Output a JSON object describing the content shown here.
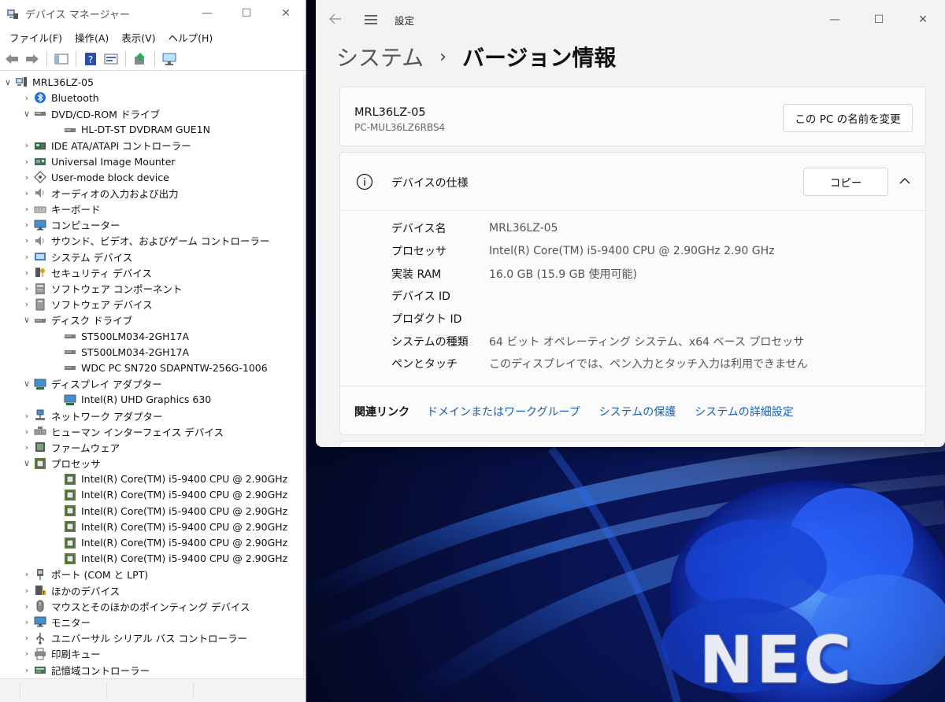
{
  "devmgr": {
    "title": "デバイス マネージャー",
    "controls": [
      "—",
      "☐",
      "✕"
    ],
    "menus": [
      "ファイル(F)",
      "操作(A)",
      "表示(V)",
      "ヘルプ(H)"
    ],
    "tree": [
      {
        "level": 0,
        "exp": "∨",
        "icon": "computer-icon",
        "label": "MRL36LZ-05"
      },
      {
        "level": 1,
        "exp": "›",
        "icon": "bluetooth-icon",
        "label": "Bluetooth"
      },
      {
        "level": 1,
        "exp": "∨",
        "icon": "dvd-drive-icon",
        "label": "DVD/CD-ROM ドライブ"
      },
      {
        "level": 2,
        "exp": "",
        "icon": "dvd-drive-icon",
        "label": "HL-DT-ST DVDRAM GUE1N"
      },
      {
        "level": 1,
        "exp": "›",
        "icon": "ide-controller-icon",
        "label": "IDE ATA/ATAPI コントローラー"
      },
      {
        "level": 1,
        "exp": "›",
        "icon": "controller-icon",
        "label": "Universal Image Mounter"
      },
      {
        "level": 1,
        "exp": "›",
        "icon": "block-device-icon",
        "label": "User-mode block device"
      },
      {
        "level": 1,
        "exp": "›",
        "icon": "speaker-icon",
        "label": "オーディオの入力および出力"
      },
      {
        "level": 1,
        "exp": "›",
        "icon": "keyboard-icon",
        "label": "キーボード"
      },
      {
        "level": 1,
        "exp": "›",
        "icon": "monitor-icon",
        "label": "コンピューター"
      },
      {
        "level": 1,
        "exp": "›",
        "icon": "speaker-icon",
        "label": "サウンド、ビデオ、およびゲーム コントローラー"
      },
      {
        "level": 1,
        "exp": "›",
        "icon": "system-folder-icon",
        "label": "システム デバイス"
      },
      {
        "level": 1,
        "exp": "›",
        "icon": "security-key-icon",
        "label": "セキュリティ デバイス"
      },
      {
        "level": 1,
        "exp": "›",
        "icon": "software-component-icon",
        "label": "ソフトウェア コンポーネント"
      },
      {
        "level": 1,
        "exp": "›",
        "icon": "software-device-icon",
        "label": "ソフトウェア デバイス"
      },
      {
        "level": 1,
        "exp": "∨",
        "icon": "disk-drive-icon",
        "label": "ディスク ドライブ"
      },
      {
        "level": 2,
        "exp": "",
        "icon": "disk-drive-icon",
        "label": "ST500LM034-2GH17A"
      },
      {
        "level": 2,
        "exp": "",
        "icon": "disk-drive-icon",
        "label": "ST500LM034-2GH17A"
      },
      {
        "level": 2,
        "exp": "",
        "icon": "disk-drive-icon",
        "label": "WDC PC SN720 SDAPNTW-256G-1006"
      },
      {
        "level": 1,
        "exp": "∨",
        "icon": "display-adapter-icon",
        "label": "ディスプレイ アダプター"
      },
      {
        "level": 2,
        "exp": "",
        "icon": "display-adapter-icon",
        "label": "Intel(R) UHD Graphics 630"
      },
      {
        "level": 1,
        "exp": "›",
        "icon": "network-adapter-icon",
        "label": "ネットワーク アダプター"
      },
      {
        "level": 1,
        "exp": "›",
        "icon": "hid-icon",
        "label": "ヒューマン インターフェイス デバイス"
      },
      {
        "level": 1,
        "exp": "›",
        "icon": "firmware-icon",
        "label": "ファームウェア"
      },
      {
        "level": 1,
        "exp": "∨",
        "icon": "processor-icon",
        "label": "プロセッサ"
      },
      {
        "level": 2,
        "exp": "",
        "icon": "processor-icon",
        "label": "Intel(R) Core(TM) i5-9400 CPU @ 2.90GHz"
      },
      {
        "level": 2,
        "exp": "",
        "icon": "processor-icon",
        "label": "Intel(R) Core(TM) i5-9400 CPU @ 2.90GHz"
      },
      {
        "level": 2,
        "exp": "",
        "icon": "processor-icon",
        "label": "Intel(R) Core(TM) i5-9400 CPU @ 2.90GHz"
      },
      {
        "level": 2,
        "exp": "",
        "icon": "processor-icon",
        "label": "Intel(R) Core(TM) i5-9400 CPU @ 2.90GHz"
      },
      {
        "level": 2,
        "exp": "",
        "icon": "processor-icon",
        "label": "Intel(R) Core(TM) i5-9400 CPU @ 2.90GHz"
      },
      {
        "level": 2,
        "exp": "",
        "icon": "processor-icon",
        "label": "Intel(R) Core(TM) i5-9400 CPU @ 2.90GHz"
      },
      {
        "level": 1,
        "exp": "›",
        "icon": "port-icon",
        "label": "ポート (COM と LPT)"
      },
      {
        "level": 1,
        "exp": "›",
        "icon": "other-device-icon",
        "label": "ほかのデバイス"
      },
      {
        "level": 1,
        "exp": "›",
        "icon": "mouse-icon",
        "label": "マウスとそのほかのポインティング デバイス"
      },
      {
        "level": 1,
        "exp": "›",
        "icon": "monitor-icon",
        "label": "モニター"
      },
      {
        "level": 1,
        "exp": "›",
        "icon": "usb-icon",
        "label": "ユニバーサル シリアル バス コントローラー"
      },
      {
        "level": 1,
        "exp": "›",
        "icon": "printer-icon",
        "label": "印刷キュー"
      },
      {
        "level": 1,
        "exp": "›",
        "icon": "storage-controller-icon",
        "label": "記憶域コントローラー"
      }
    ]
  },
  "settings": {
    "app_title": "設定",
    "controls": [
      "—",
      "☐",
      "✕"
    ],
    "breadcrumb": {
      "parent": "システム",
      "separator": "›",
      "current": "バージョン情報"
    },
    "device": {
      "name": "MRL36LZ-05",
      "model": "PC-MUL36LZ6RBS4",
      "rename_label": "この PC の名前を変更"
    },
    "spec": {
      "title": "デバイスの仕様",
      "copy_label": "コピー",
      "rows": [
        {
          "label": "デバイス名",
          "value": "MRL36LZ-05"
        },
        {
          "label": "プロセッサ",
          "value": "Intel(R) Core(TM) i5-9400 CPU @ 2.90GHz   2.90 GHz"
        },
        {
          "label": "実装 RAM",
          "value": "16.0 GB (15.9 GB 使用可能)"
        },
        {
          "label": "デバイス ID",
          "value": ""
        },
        {
          "label": "プロダクト ID",
          "value": ""
        },
        {
          "label": "システムの種類",
          "value": "64 ビット オペレーティング システム、x64 ベース プロセッサ"
        },
        {
          "label": "ペンとタッチ",
          "value": "このディスプレイでは、ペン入力とタッチ入力は利用できません"
        }
      ],
      "related_label": "関連リンク",
      "related_links": [
        "ドメインまたはワークグループ",
        "システムの保護",
        "システムの詳細設定"
      ]
    }
  },
  "desktop": {
    "logo": "NEC"
  }
}
